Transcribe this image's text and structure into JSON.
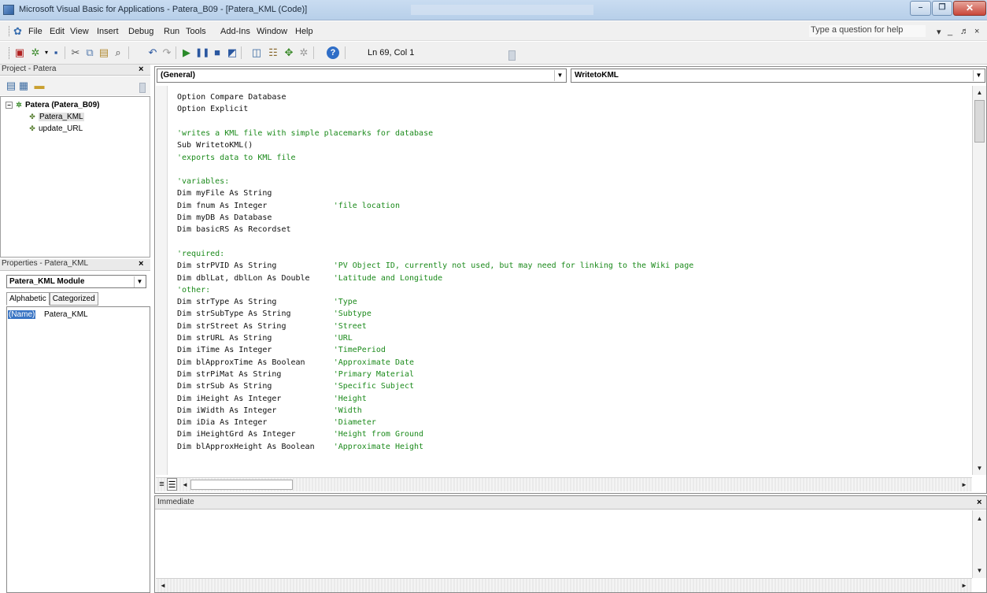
{
  "window": {
    "title": "Microsoft Visual Basic for Applications - Patera_B09 - [Patera_KML (Code)]",
    "minimize_glyph": "–",
    "maximize_glyph": "❐",
    "close_glyph": "✕"
  },
  "menubar": {
    "items": [
      "File",
      "Edit",
      "View",
      "Insert",
      "Debug",
      "Run",
      "Tools",
      "Add-Ins",
      "Window",
      "Help"
    ],
    "help_placeholder": "Type a question for help",
    "mdi_controls": [
      "▾",
      "_",
      "♬",
      "×"
    ]
  },
  "toolbar": {
    "position": "Ln 69, Col 1"
  },
  "project_pane": {
    "title": "Project - Patera",
    "close": "×",
    "root": "Patera (Patera_B09)",
    "modules": [
      "Patera_KML",
      "update_URL"
    ]
  },
  "properties_pane": {
    "title": "Properties - Patera_KML",
    "close": "×",
    "object": "Patera_KML Module",
    "tabs": [
      "Alphabetic",
      "Categorized"
    ],
    "prop_name": "(Name)",
    "prop_value": "Patera_KML"
  },
  "code_window": {
    "object_combo": "(General)",
    "proc_combo": "WritetoKML",
    "lines": [
      {
        "code": "Option Compare Database",
        "comment": ""
      },
      {
        "code": "Option Explicit",
        "comment": ""
      },
      {
        "code": "",
        "comment": ""
      },
      {
        "code": "",
        "comment": "'writes a KML file with simple placemarks for database"
      },
      {
        "code": "Sub WritetoKML()",
        "comment": ""
      },
      {
        "code": "",
        "comment": "'exports data to KML file"
      },
      {
        "code": "",
        "comment": ""
      },
      {
        "code": "",
        "comment": "'variables:"
      },
      {
        "code": "Dim myFile As String",
        "comment": ""
      },
      {
        "code": "Dim fnum As Integer              ",
        "comment": "'file location"
      },
      {
        "code": "Dim myDB As Database",
        "comment": ""
      },
      {
        "code": "Dim basicRS As Recordset",
        "comment": ""
      },
      {
        "code": "",
        "comment": ""
      },
      {
        "code": "",
        "comment": "'required:"
      },
      {
        "code": "Dim strPVID As String            ",
        "comment": "'PV Object ID, currently not used, but may need for linking to the Wiki page"
      },
      {
        "code": "Dim dblLat, dblLon As Double     ",
        "comment": "'Latitude and Longitude"
      },
      {
        "code": "",
        "comment": "'other:"
      },
      {
        "code": "Dim strType As String            ",
        "comment": "'Type"
      },
      {
        "code": "Dim strSubType As String         ",
        "comment": "'Subtype"
      },
      {
        "code": "Dim strStreet As String          ",
        "comment": "'Street"
      },
      {
        "code": "Dim strURL As String             ",
        "comment": "'URL"
      },
      {
        "code": "Dim iTime As Integer             ",
        "comment": "'TimePeriod"
      },
      {
        "code": "Dim blApproxTime As Boolean      ",
        "comment": "'Approximate Date"
      },
      {
        "code": "Dim strPiMat As String           ",
        "comment": "'Primary Material"
      },
      {
        "code": "Dim strSub As String             ",
        "comment": "'Specific Subject"
      },
      {
        "code": "Dim iHeight As Integer           ",
        "comment": "'Height"
      },
      {
        "code": "Dim iWidth As Integer            ",
        "comment": "'Width"
      },
      {
        "code": "Dim iDia As Integer              ",
        "comment": "'Diameter"
      },
      {
        "code": "Dim iHeightGrd As Integer        ",
        "comment": "'Height from Ground"
      },
      {
        "code": "Dim blApproxHeight As Boolean    ",
        "comment": "'Approximate Height"
      }
    ]
  },
  "immediate_pane": {
    "title": "Immediate",
    "close": "×"
  },
  "icons": {
    "app": "vba-icon",
    "up": "▲",
    "down": "▼",
    "left": "◄",
    "right": "►",
    "dropdown": "▼"
  }
}
